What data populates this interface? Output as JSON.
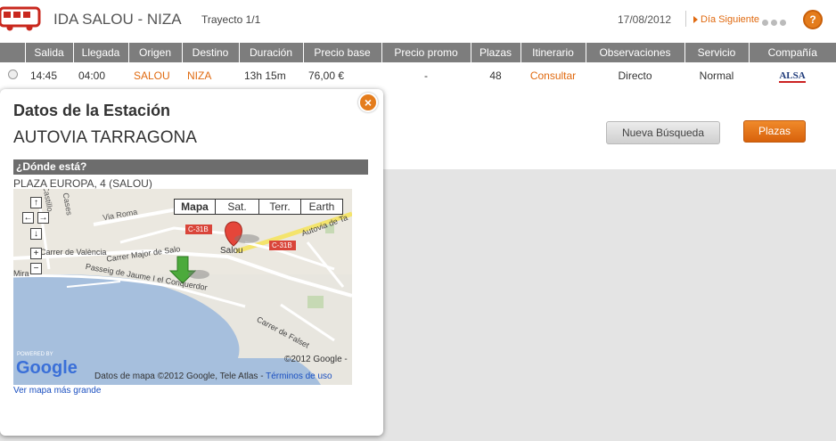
{
  "header": {
    "route_title": "IDA SALOU - NIZA",
    "trayecto": "Trayecto 1/1",
    "date": "17/08/2012",
    "next_day": "Día Siguiente",
    "help_icon": "?"
  },
  "table": {
    "headers": [
      "Salida",
      "Llegada",
      "Origen",
      "Destino",
      "Duración",
      "Precio base",
      "Precio promo",
      "Plazas",
      "Itinerario",
      "Observaciones",
      "Servicio",
      "Compañía"
    ],
    "rows": [
      {
        "salida": "14:45",
        "llegada": "04:00",
        "origen": "SALOU",
        "destino": "NIZA",
        "duracion": "13h 15m",
        "precio_base": "76,00 €",
        "precio_promo": "-",
        "plazas": "48",
        "itinerario": "Consultar",
        "observaciones": "Directo",
        "servicio": "Normal",
        "compania": "ALSA"
      }
    ]
  },
  "buttons": {
    "nueva_busqueda": "Nueva Búsqueda",
    "plazas": "Plazas"
  },
  "popup": {
    "title": "Datos de la Estación",
    "station_name": "AUTOVIA TARRAGONA",
    "section_label": "¿Dónde está?",
    "address": "PLAZA EUROPA, 4 (SALOU)",
    "close_icon": "×",
    "bigger_map_link": "Ver mapa más grande",
    "map": {
      "types": [
        "Mapa",
        "Sat.",
        "Terr.",
        "Earth"
      ],
      "active_type": "Mapa",
      "copyright": "©2012 Google -",
      "data_credit": "Datos de mapa ©2012 Google, Tele Atlas -",
      "terms_link": "Términos de uso",
      "powered_by": "POWERED BY",
      "logo_text": "Google",
      "labels": {
        "via_roma": "Via Roma",
        "road_c31b_1": "C-31B",
        "road_c31b_2": "C-31B",
        "autovia": "Autovia de Ta",
        "salou": "Salou",
        "carrer_major": "Carrer Major de Salo",
        "carrer_valencia": "Carrer de València",
        "passeig": "Passeig de Jaume I el Conquerdor",
        "carrer_falset": "Carrer de Falset",
        "castillo": "Castillo",
        "cases": "Cases",
        "mira": "Mira"
      }
    }
  },
  "colors": {
    "accent_orange": "#e06a10",
    "header_gray": "#7d7d7d",
    "link_blue": "#1a4fc0"
  }
}
